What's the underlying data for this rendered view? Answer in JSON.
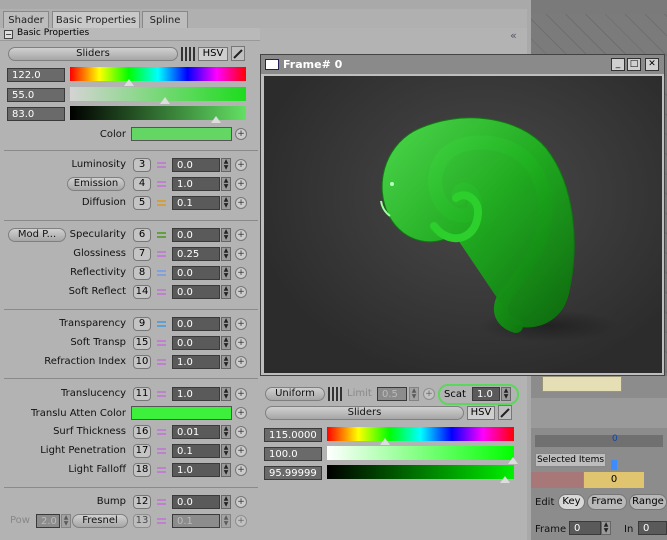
{
  "tabs": [
    "Shader",
    "Basic Properties",
    "Spline"
  ],
  "section": {
    "title": "Basic Properties"
  },
  "color_mode": {
    "sliders": "Sliders",
    "mode": "HSV"
  },
  "hsv": {
    "h": "122.0",
    "s": "55.0",
    "v": "83.0"
  },
  "color_label": "Color",
  "colors": {
    "shader": "#63d663",
    "translucent": "#3cf03c",
    "accent": "#5cd65c",
    "window_title": "#8a8a8a"
  },
  "props": [
    {
      "label": "Luminosity",
      "index": "3",
      "value": "0.0"
    },
    {
      "label": "Emission",
      "index": "4",
      "value": "1.0",
      "button": true
    },
    {
      "label": "Diffusion",
      "index": "5",
      "value": "0.1"
    },
    {
      "label": "Specularity",
      "index": "6",
      "value": "0.0",
      "mod": "Mod P..."
    },
    {
      "label": "Glossiness",
      "index": "7",
      "value": "0.25"
    },
    {
      "label": "Reflectivity",
      "index": "8",
      "value": "0.0"
    },
    {
      "label": "Soft Reflect",
      "index": "14",
      "value": "0.0"
    },
    {
      "label": "Transparency",
      "index": "9",
      "value": "0.0"
    },
    {
      "label": "Soft Transp",
      "index": "15",
      "value": "0.0"
    },
    {
      "label": "Refraction Index",
      "index": "10",
      "value": "1.0"
    },
    {
      "label": "Translucency",
      "index": "11",
      "value": "1.0"
    },
    {
      "label": "Translu Atten Color"
    },
    {
      "label": "Surf Thickness",
      "index": "16",
      "value": "0.01"
    },
    {
      "label": "Light Penetration",
      "index": "17",
      "value": "0.1"
    },
    {
      "label": "Light Falloff",
      "index": "18",
      "value": "1.0"
    },
    {
      "label": "Bump",
      "index": "12",
      "value": "0.0"
    },
    {
      "label": "Fresnel",
      "index": "13",
      "value": "0.1",
      "pow_label": "Pow",
      "pow_value": "2.0"
    }
  ],
  "trans": {
    "uniform": "Uniform",
    "limit_label": "Limit",
    "limit_value": "0.5",
    "scat_label": "Scat",
    "scat_value": "1.0",
    "sliders": "Sliders",
    "mode": "HSV",
    "h": "115.0000",
    "s": "100.0",
    "v": "95.99999"
  },
  "render_window": {
    "title": "Frame# 0"
  },
  "timeline": {
    "value": "0",
    "selected_items": "Selected Items",
    "frame_value": "0",
    "edit_label": "Edit",
    "tabs": [
      "Key",
      "Frame",
      "Range"
    ],
    "frame_label": "Frame",
    "frame_field": "0",
    "in_label": "In",
    "in_field": "0"
  }
}
